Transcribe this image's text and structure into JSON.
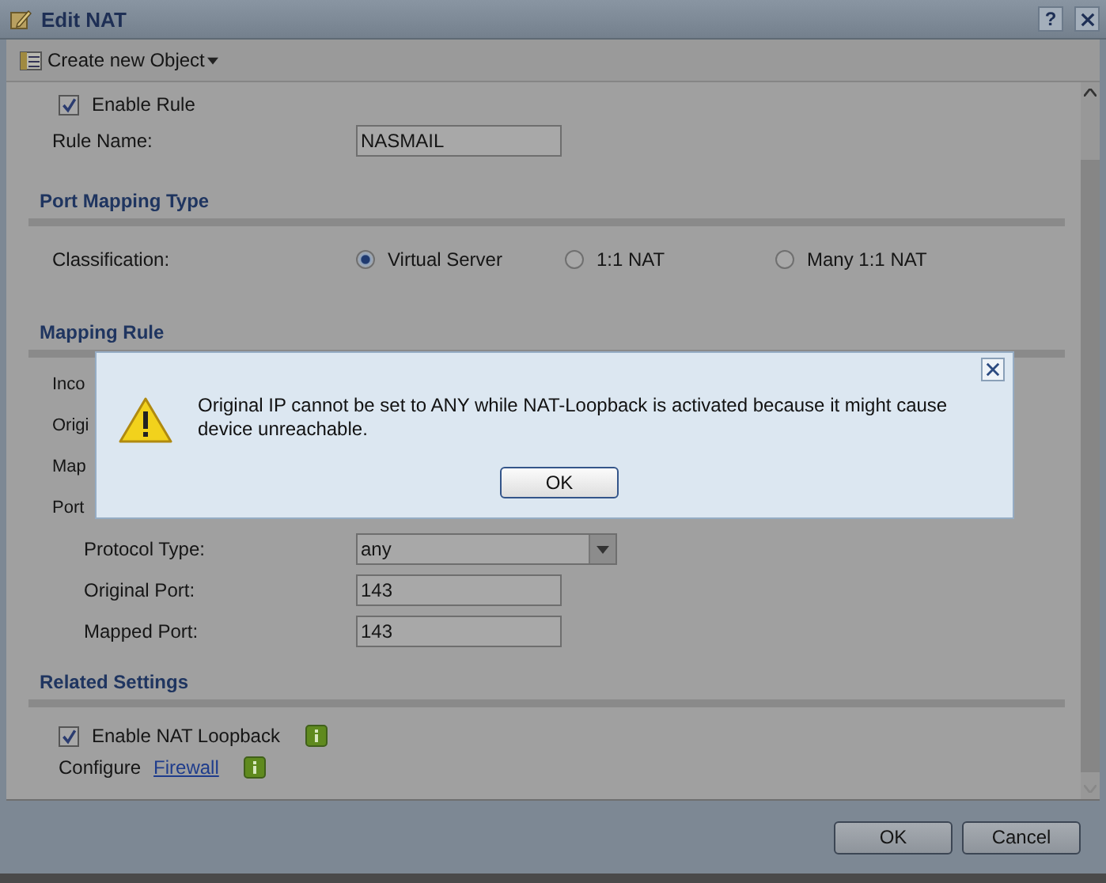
{
  "window": {
    "title": "Edit NAT",
    "help": "?"
  },
  "toolbar": {
    "label": "Create new Object"
  },
  "enable_rule": {
    "label": "Enable Rule",
    "checked": true
  },
  "rule_name": {
    "label": "Rule Name:",
    "value": "NASMAIL"
  },
  "port_mapping_type": {
    "heading": "Port Mapping Type",
    "label": "Classification:",
    "options": [
      {
        "label": "Virtual Server",
        "selected": true
      },
      {
        "label": "1:1 NAT",
        "selected": false
      },
      {
        "label": "Many 1:1 NAT",
        "selected": false
      }
    ]
  },
  "mapping_rule": {
    "heading": "Mapping Rule",
    "rows": [
      {
        "label": "Inco"
      },
      {
        "label": "Origi"
      },
      {
        "label": "Map"
      },
      {
        "label": "Port",
        "children": [
          {
            "kind": "select",
            "label": "Protocol Type:",
            "value": "any"
          },
          {
            "kind": "text",
            "label": "Original Port:",
            "value": "143"
          },
          {
            "kind": "text",
            "label": "Mapped Port:",
            "value": "143"
          }
        ]
      }
    ]
  },
  "related_settings": {
    "heading": "Related Settings",
    "loopback": {
      "label": "Enable NAT Loopback",
      "checked": true
    },
    "configure": {
      "label": "Configure",
      "link": "Firewall"
    }
  },
  "buttons": [
    "OK",
    "Cancel"
  ],
  "alert": {
    "message": "Original IP cannot be set to ANY while NAT-Loopback is activated because it might cause device unreachable.",
    "button": "OK"
  }
}
